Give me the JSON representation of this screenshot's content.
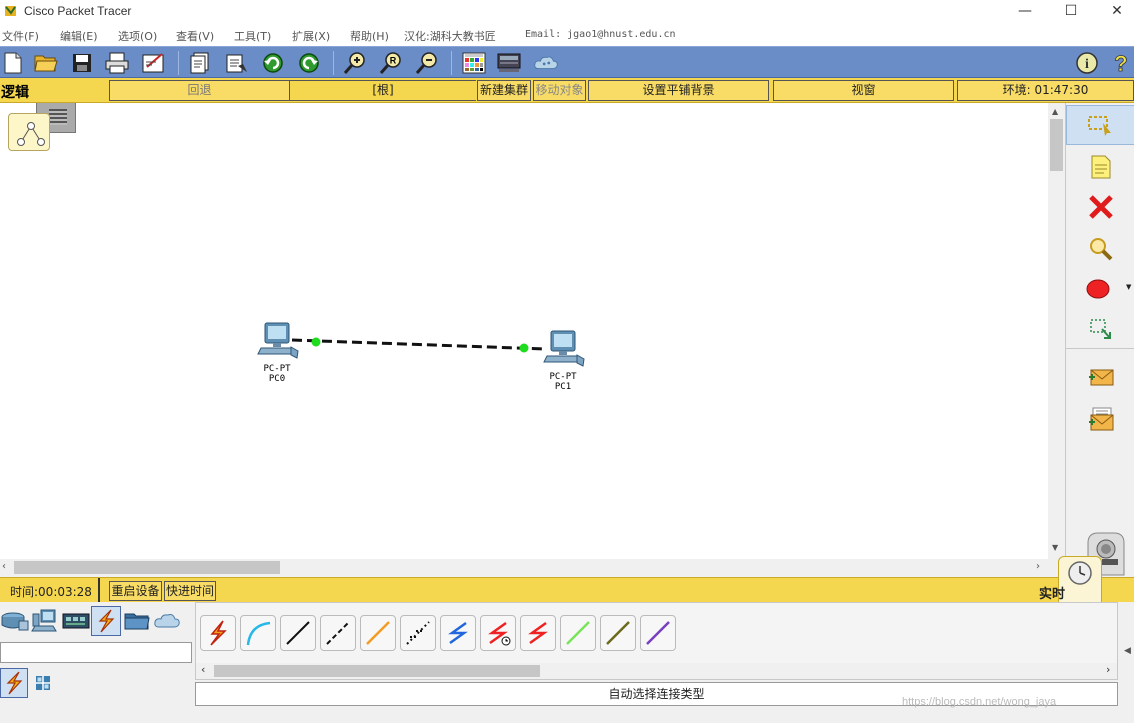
{
  "window": {
    "title": "Cisco Packet Tracer",
    "controls": [
      "—",
      "☐",
      "✕"
    ]
  },
  "menu": {
    "items": [
      "文件(F)",
      "编辑(E)",
      "选项(O)",
      "查看(V)",
      "工具(T)",
      "扩展(X)",
      "帮助(H)",
      "汉化:湖科大教书匠"
    ],
    "email": "Email: jgao1@hnust.edu.cn"
  },
  "toolbar": {
    "icons": [
      "new-file-icon",
      "open-folder-icon",
      "save-icon",
      "print-icon",
      "activity-wizard-icon",
      "copy-icon",
      "paste-icon",
      "undo-icon",
      "redo-icon",
      "zoom-in-icon",
      "zoom-reset-icon",
      "zoom-out-icon",
      "palette-icon",
      "custom-device-icon",
      "cluster-cloud-icon",
      "info-icon",
      "help-icon"
    ]
  },
  "workspace": {
    "mode": "逻辑",
    "back": "回退",
    "root": "[根]",
    "new_cluster": "新建集群",
    "move_object": "移动对象",
    "set_tiled_bg": "设置平铺背景",
    "viewport": "视窗",
    "environment": "环境: 01:47:30"
  },
  "devices": [
    {
      "type": "PC-PT",
      "name": "PC0"
    },
    {
      "type": "PC-PT",
      "name": "PC1"
    }
  ],
  "status": {
    "time": "时间:00:03:28",
    "power_cycle": "重启设备",
    "fast_forward": "快进时间",
    "realtime": "实时"
  },
  "connections": {
    "selected_label": "自动选择连接类型",
    "types": [
      "auto-connection-icon",
      "console-cable-icon",
      "straight-through-cable-icon",
      "crossover-cable-icon",
      "fiber-cable-icon",
      "phone-cable-icon",
      "coaxial-cable-icon",
      "serial-dce-cable-icon",
      "serial-dte-cable-icon",
      "octal-cable-icon",
      "iot-custom-cable-icon",
      "usb-cable-icon"
    ]
  },
  "watermark": "https://blog.csdn.net/wong_jaya"
}
